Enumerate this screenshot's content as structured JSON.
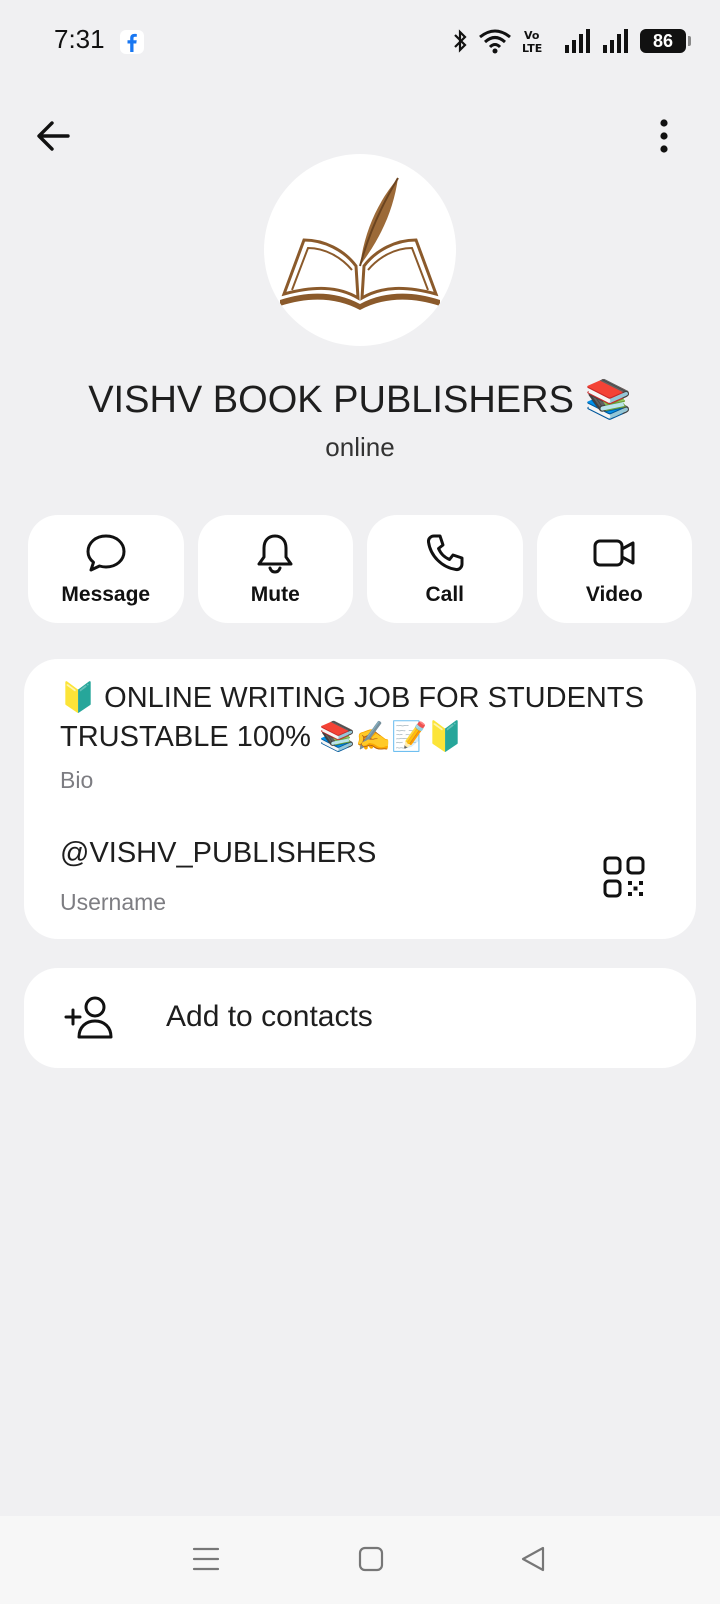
{
  "status_bar": {
    "time": "7:31",
    "battery": "86",
    "icons": [
      "facebook-icon",
      "bluetooth-icon",
      "wifi-icon",
      "volte-icon",
      "signal-icon",
      "signal-icon"
    ]
  },
  "profile": {
    "name": "VISHV BOOK PUBLISHERS 📚",
    "status": "online"
  },
  "actions": [
    {
      "label": "Message",
      "icon": "message-bubble-icon"
    },
    {
      "label": "Mute",
      "icon": "bell-icon"
    },
    {
      "label": "Call",
      "icon": "phone-icon"
    },
    {
      "label": "Video",
      "icon": "video-camera-icon"
    }
  ],
  "info": {
    "bio": "🔰 ONLINE WRITING JOB FOR STUDENTS TRUSTABLE 100% 📚✍️📝🔰",
    "bio_label": "Bio",
    "username": "@VISHV_PUBLISHERS",
    "username_label": "Username"
  },
  "contact": {
    "add_label": "Add to contacts"
  },
  "colors": {
    "background": "#f0f0f2",
    "card": "#ffffff",
    "secondary_text": "#7d7d82",
    "avatar_brown": "#8b5a2b"
  }
}
